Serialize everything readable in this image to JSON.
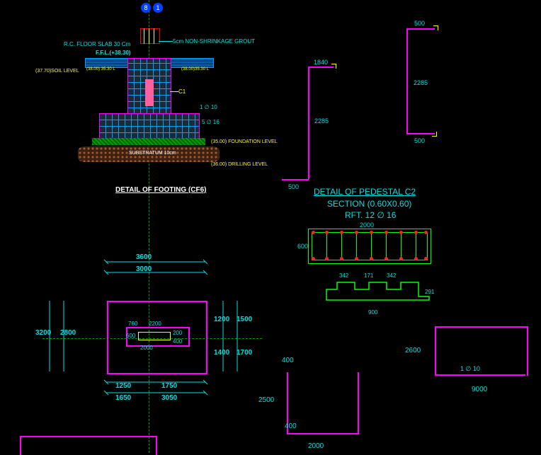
{
  "footing_section": {
    "slab_label": "R.C. FLOOR SLAB 30 Cm",
    "ffl_label": "F.F.L.(+38.30)",
    "soil_level_left": "(37.70)SOIL LEVEL",
    "lt_left": "(38.00) 35.30 L",
    "lt_right": "(38.00)35.30 L",
    "grout_note": "5cm NON-SHRINKAGE GROUT",
    "c1_label": "C1",
    "rebar_note_top": "1 ∅ 10",
    "rebar_note_bottom": "5 ∅ 16",
    "foundation_level": "(35.00) FOUNDATION LEVEL",
    "substratum": "SUBSTRATUM 10cm",
    "drilling_level": "(36.00) DRILLING LEVEL",
    "title": "DETAIL OF FOOTING (CF6)"
  },
  "pedestal_c2": {
    "dims": {
      "a": "500",
      "b": "2285",
      "c": "500",
      "d": "2285",
      "e": "500",
      "f": "1840"
    },
    "title1": "DETAIL OF PEDESTAL C2",
    "title2": "SECTION (0.60X0.60)",
    "title3": "RFT. 12 ∅ 16"
  },
  "plan": {
    "outer_w": "3000",
    "outer_w2": "3600",
    "outer_h": "2800",
    "outer_h2": "3200",
    "r1": "1200",
    "r2": "1500",
    "r3": "1400",
    "r4": "1700",
    "b1": "1250",
    "b2": "1750",
    "b3": "1650",
    "b4": "3050",
    "inner_w": "2000",
    "inner_h": "600",
    "inner_w2": "2200",
    "small1": "760",
    "small2": "400",
    "small3": "200"
  },
  "beam_cross": {
    "w": "2000",
    "h": "600",
    "detail1": "342",
    "detail2": "171",
    "detail3": "342",
    "detail4": "900",
    "detail5": "291"
  },
  "u_shapes": {
    "left": {
      "w": "2000",
      "h": "2500",
      "flange": "400",
      "top": "400"
    },
    "right": {
      "w": "9000",
      "h": "2600",
      "note": "1 ∅ 10"
    }
  },
  "bubbles": {
    "a": "8",
    "b": "1"
  },
  "ui": {
    "icon_axis": "axis-bubbles"
  }
}
